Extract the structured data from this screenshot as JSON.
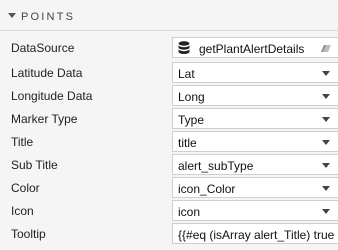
{
  "section": {
    "title": "POINTS"
  },
  "rows": [
    {
      "label": "DataSource",
      "value": "getPlantAlertDetails"
    },
    {
      "label": "Latitude Data",
      "value": "Lat"
    },
    {
      "label": "Longitude Data",
      "value": "Long"
    },
    {
      "label": "Marker Type",
      "value": "Type"
    },
    {
      "label": "Title",
      "value": "title"
    },
    {
      "label": "Sub Title",
      "value": "alert_subType"
    },
    {
      "label": "Color",
      "value": "icon_Color"
    },
    {
      "label": "Icon",
      "value": "icon"
    },
    {
      "label": "Tooltip",
      "value": "{{#eq (isArray alert_Title) true"
    }
  ]
}
